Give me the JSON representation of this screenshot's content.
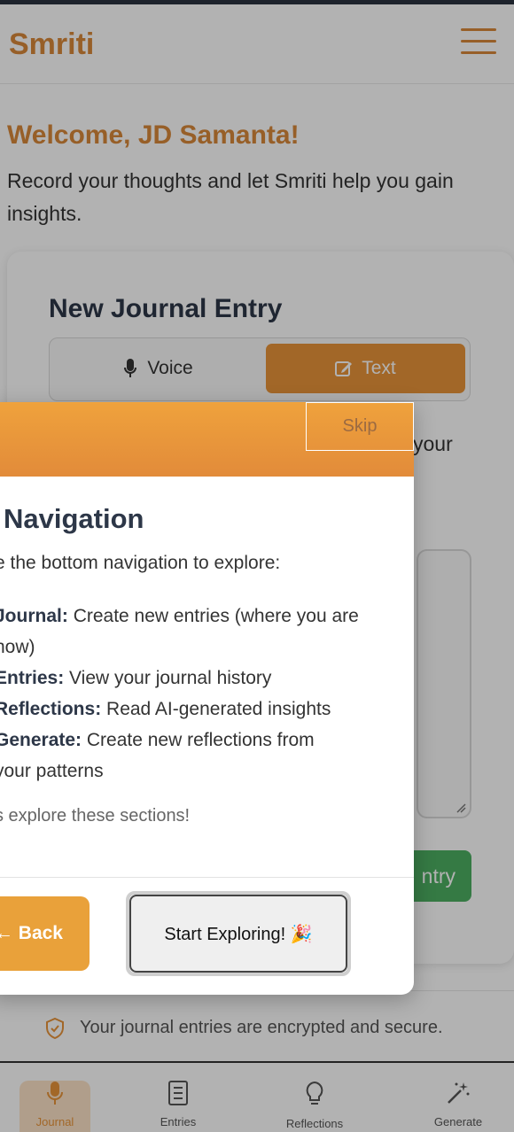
{
  "app": {
    "brand": "Smriti"
  },
  "welcome": {
    "title": "Welcome, JD Samanta!",
    "subtitle": "Record your thoughts and let Smriti help you gain insights."
  },
  "entry_card": {
    "title": "New Journal Entry",
    "mode_voice": "Voice",
    "mode_text": "Text",
    "behind_text": "your",
    "save_partial": "ntry"
  },
  "security": {
    "text": "Your journal entries are encrypted and secure."
  },
  "bottom_nav": {
    "items": [
      {
        "label": "Journal",
        "icon": "mic-icon"
      },
      {
        "label": "Entries",
        "icon": "entries-icon"
      },
      {
        "label": "Reflections",
        "icon": "lightbulb-icon"
      },
      {
        "label": "Generate",
        "icon": "magic-wand-icon"
      }
    ]
  },
  "modal": {
    "skip": "Skip",
    "title": "Navigation",
    "subtitle": "e the bottom navigation to explore:",
    "items": [
      {
        "name": "Journal:",
        "desc": "Create new entries (where you are",
        "cont": "now)"
      },
      {
        "name": "Entries:",
        "desc": "View your journal history"
      },
      {
        "name": "Reflections:",
        "desc": "Read AI-generated insights"
      },
      {
        "name": "Generate:",
        "desc": "Create new reflections from",
        "cont": "your patterns"
      }
    ],
    "footer_text": "s explore these sections!",
    "back": "← Back",
    "start": "Start Exploring! 🎉"
  },
  "colors": {
    "accent": "#e8943a",
    "success": "#4caf62",
    "heading": "#2d3748"
  }
}
